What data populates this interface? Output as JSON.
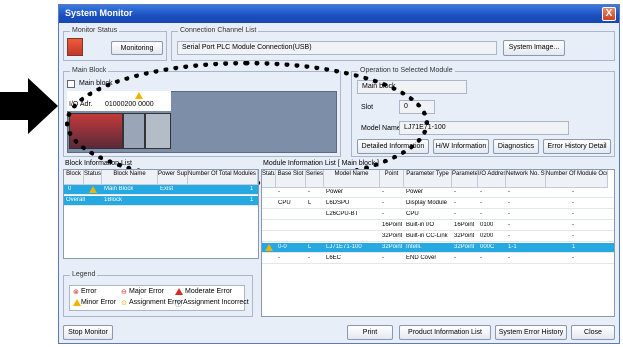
{
  "window": {
    "title": "System Monitor",
    "close": "X"
  },
  "monitor_status": {
    "title": "Monitor Status",
    "button": "Monitoring"
  },
  "connection": {
    "title": "Connection Channel List",
    "value": "Serial Port  PLC Module Connection(USB)",
    "system_image": "System Image..."
  },
  "main_block": {
    "title": "Main Block",
    "checkbox_label": "Main block",
    "io_adr_label": "I/O Adr.",
    "io_adr_value": "01000200 0000"
  },
  "operation": {
    "title": "Operation to Selected Module",
    "block_value": "Main block",
    "slot_label": "Slot",
    "slot_value": "0",
    "model_label": "Model Name",
    "model_value": "LJ71E71-100",
    "buttons": [
      "Detailed Information",
      "H/W Information",
      "Diagnostics",
      "Error History Detail"
    ]
  },
  "block_list": {
    "title": "Block Information List",
    "headers": [
      "Block",
      "Status",
      "Block Name",
      "Power Supply",
      "Number Of Total Modules Occupations"
    ],
    "rows": [
      {
        "block": "0",
        "name": "Main Block",
        "power": "Exist",
        "occ": "1"
      },
      {
        "block": "Overall",
        "name": "1Block",
        "power": "",
        "occ": "1"
      }
    ]
  },
  "module_list": {
    "title": "Module Information List [ Main block ]",
    "headers": [
      "Status",
      "Base Slot",
      "Series",
      "Model Name",
      "Point",
      "Parameter Type",
      "Parameter Point",
      "I/O Address",
      "Network No. Station No.",
      "Number Of Module Occupied"
    ],
    "rows": [
      {
        "status": "",
        "slot": "-",
        "series": "-",
        "model": "Power",
        "point": "-",
        "ptype": "Power",
        "ppoint": "-",
        "io": "-",
        "net": "-",
        "occ": "-"
      },
      {
        "status": "",
        "slot": "CPU",
        "series": "L",
        "model": "L6DSPU",
        "point": "-",
        "ptype": "Display Module",
        "ppoint": "-",
        "io": "-",
        "net": "-",
        "occ": "-"
      },
      {
        "status": "",
        "slot": "",
        "series": "",
        "model": "L26CPU-BT",
        "point": "-",
        "ptype": "CPU",
        "ppoint": "-",
        "io": "-",
        "net": "-",
        "occ": "-"
      },
      {
        "status": "",
        "slot": "",
        "series": "",
        "model": "",
        "point": "16Point",
        "ptype": "Built-in I/O",
        "ppoint": "16Point",
        "io": "0100",
        "net": "-",
        "occ": "-"
      },
      {
        "status": "",
        "slot": "",
        "series": "",
        "model": "",
        "point": "32Point",
        "ptype": "Built-in CC-Link",
        "ppoint": "32Point",
        "io": "0200",
        "net": "-",
        "occ": "-"
      },
      {
        "status": "warn",
        "slot": "0-0",
        "series": "L",
        "model": "LJ71E71-100",
        "point": "32Point",
        "ptype": "Intelli.",
        "ppoint": "32Point",
        "io": "000C",
        "net": "1-1",
        "occ": "1"
      },
      {
        "status": "",
        "slot": "-",
        "series": "-",
        "model": "L6EC",
        "point": "-",
        "ptype": "END Cover",
        "ppoint": "-",
        "io": "-",
        "net": "-",
        "occ": "-"
      }
    ]
  },
  "legend": {
    "title": "Legend",
    "items": [
      "Error",
      "Major Error",
      "Moderate Error",
      "Minor Error",
      "Assignment Error",
      "Assignment Incorrect"
    ]
  },
  "footer": {
    "stop": "Stop Monitor",
    "print": "Print",
    "product": "Product Information List",
    "history": "System Error History",
    "close": "Close"
  },
  "colors": {
    "selection": "#25a9e0",
    "callout": "#000000",
    "warning": "#f0b400",
    "error": "#d62b1f"
  }
}
